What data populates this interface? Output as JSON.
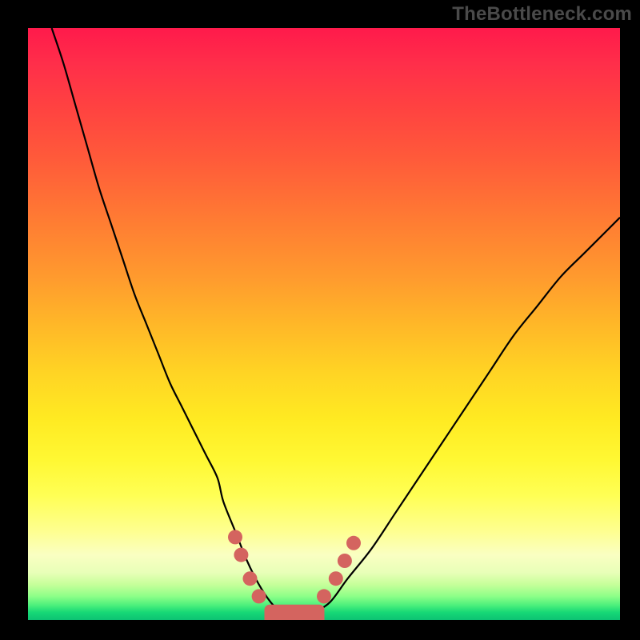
{
  "watermark": "TheBottleneck.com",
  "colors": {
    "curve": "#000000",
    "marker": "#d4645f",
    "frame": "#000000"
  },
  "chart_data": {
    "type": "line",
    "title": "",
    "xlabel": "",
    "ylabel": "",
    "xlim": [
      0,
      100
    ],
    "ylim": [
      0,
      100
    ],
    "grid": false,
    "legend": false,
    "series": [
      {
        "name": "bottleneck-curve",
        "x": [
          4,
          6,
          8,
          10,
          12,
          14,
          16,
          18,
          20,
          22,
          24,
          26,
          28,
          30,
          32,
          33,
          35,
          37,
          39,
          41,
          43,
          45,
          47,
          48,
          51,
          54,
          58,
          62,
          66,
          70,
          74,
          78,
          82,
          86,
          90,
          94,
          98,
          100
        ],
        "y": [
          100,
          94,
          87,
          80,
          73,
          67,
          61,
          55,
          50,
          45,
          40,
          36,
          32,
          28,
          24,
          20,
          15,
          10,
          6,
          3,
          1,
          0,
          0,
          1,
          3,
          7,
          12,
          18,
          24,
          30,
          36,
          42,
          48,
          53,
          58,
          62,
          66,
          68
        ]
      }
    ],
    "markers": [
      {
        "name": "left-cluster-top",
        "x": 35.0,
        "y": 14.0
      },
      {
        "name": "left-cluster-a",
        "x": 36.0,
        "y": 11.0
      },
      {
        "name": "left-cluster-b",
        "x": 37.5,
        "y": 7.0
      },
      {
        "name": "left-cluster-c",
        "x": 39.0,
        "y": 4.0
      },
      {
        "name": "right-cluster-a",
        "x": 50.0,
        "y": 4.0
      },
      {
        "name": "right-cluster-b",
        "x": 52.0,
        "y": 7.0
      },
      {
        "name": "right-cluster-c",
        "x": 53.5,
        "y": 10.0
      },
      {
        "name": "right-cluster-top",
        "x": 55.0,
        "y": 13.0
      }
    ],
    "floor_band": {
      "x_start": 40,
      "x_end": 50,
      "y": 0.5,
      "thickness": 3
    }
  }
}
